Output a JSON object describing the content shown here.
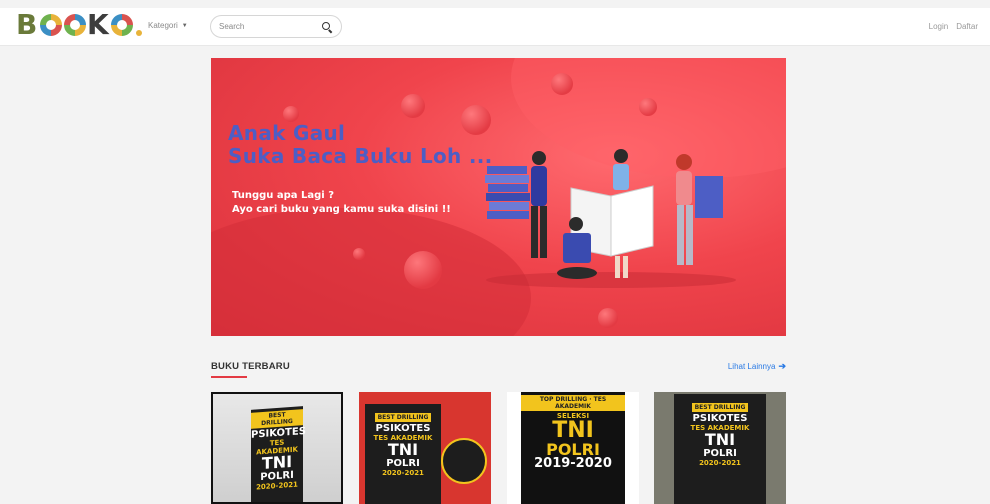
{
  "header": {
    "logo": {
      "letters": [
        "B",
        "O",
        "O",
        "K",
        "O",
        "."
      ],
      "colors": [
        "#6a7a3a",
        "#e8b33a",
        "#d9534f",
        "#3b8fc4",
        "#6fb24e"
      ]
    },
    "kategori_label": "Kategori",
    "search": {
      "placeholder": "Search",
      "value": ""
    },
    "login_label": "Login",
    "daftar_label": "Daftar"
  },
  "banner": {
    "headline_line1": "Anak Gaul",
    "headline_line2": "Suka Baca Buku Loh ...",
    "sub_line1": "Tunggu apa Lagi ?",
    "sub_line2": "Ayo cari buku yang kamu suka disini !!",
    "accent": "#e33a43",
    "headline_color": "#4d5ec5"
  },
  "section": {
    "title": "BUKU TERBARU",
    "see_more_label": "Lihat Lainnya",
    "see_more_color": "#2a7ae4"
  },
  "books": [
    {
      "tag": "BEST DRILLING",
      "line1": "PSIKOTES",
      "line2": "TES AKADEMIK",
      "line3": "TNI",
      "line4": "POLRI",
      "line5": "2020-2021"
    },
    {
      "tag": "BEST DRILLING",
      "line1": "PSIKOTES",
      "line2": "TES AKADEMIK",
      "line3": "TNI",
      "line4": "POLRI",
      "line5": "2020-2021"
    },
    {
      "tag": "TOP DRILLING · TES AKADEMIK",
      "line1": "SELEKSI",
      "line2": "",
      "line3": "TNI",
      "line4": "POLRI",
      "line5": "2019-2020"
    },
    {
      "tag": "BEST DRILLING",
      "line1": "PSIKOTES",
      "line2": "TES AKADEMIK",
      "line3": "TNI",
      "line4": "POLRI",
      "line5": "2020-2021"
    }
  ]
}
